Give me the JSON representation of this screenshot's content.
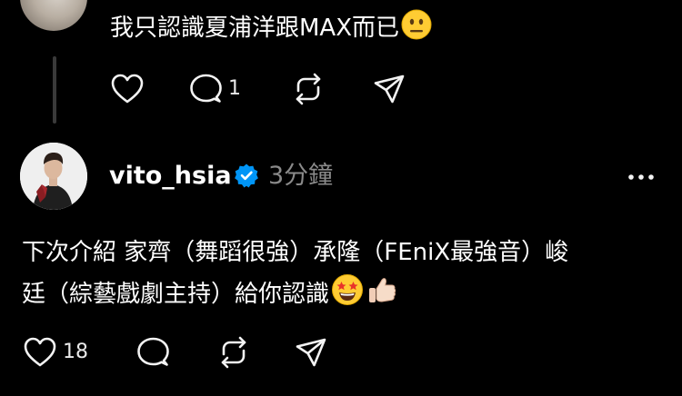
{
  "parent_post": {
    "text": "我只認識夏浦洋跟MAX而已",
    "emoji": "neutral-face",
    "actions": {
      "reply_count": "1"
    }
  },
  "reply_post": {
    "username": "vito_hsia",
    "verified": true,
    "time_ago": "3分鐘",
    "text_line1": "下次介紹 家齊（舞蹈很強）承隆（FEniX最強音）峻",
    "text_line2": "廷（綜藝戲劇主持）給你認識",
    "emojis": [
      "star-struck",
      "thumbs-up-light-skin-tone"
    ],
    "actions": {
      "like_count": "18"
    }
  },
  "colors": {
    "background": "#000000",
    "text": "#ffffff",
    "muted": "#8a8a8a",
    "verified": "#0095f6",
    "thread_line": "#3a3a3a"
  }
}
